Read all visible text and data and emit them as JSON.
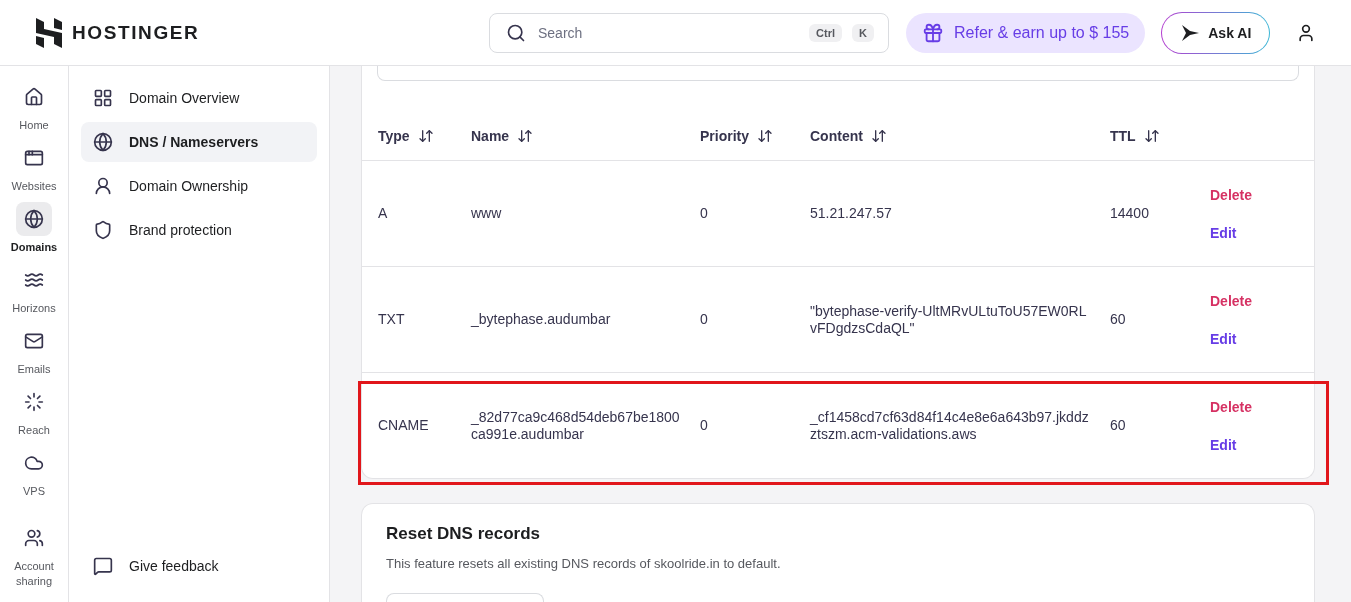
{
  "brand": {
    "name": "HOSTINGER"
  },
  "search": {
    "placeholder": "Search",
    "shortcut": [
      "Ctrl",
      "K"
    ]
  },
  "refer_button": {
    "label": "Refer & earn up to $ 155"
  },
  "ask_ai_button": {
    "label": "Ask AI"
  },
  "rail": [
    {
      "label": "Home",
      "selected": false
    },
    {
      "label": "Websites",
      "selected": false
    },
    {
      "label": "Domains",
      "selected": true
    },
    {
      "label": "Horizons",
      "selected": false
    },
    {
      "label": "Emails",
      "selected": false
    },
    {
      "label": "Reach",
      "selected": false
    },
    {
      "label": "VPS",
      "selected": false
    },
    {
      "label": "Account sharing",
      "selected": false
    }
  ],
  "subnav": {
    "items": [
      {
        "label": "Domain Overview",
        "selected": false
      },
      {
        "label": "DNS / Nameservers",
        "selected": true
      },
      {
        "label": "Domain Ownership",
        "selected": false
      },
      {
        "label": "Brand protection",
        "selected": false
      }
    ],
    "feedback": {
      "label": "Give feedback"
    }
  },
  "table": {
    "columns": [
      "Type",
      "Name",
      "Priority",
      "Content",
      "TTL"
    ],
    "rows": [
      {
        "type": "A",
        "name": "www",
        "priority": "0",
        "content": "51.21.247.57",
        "ttl": "14400",
        "delete": "Delete",
        "edit": "Edit",
        "highlighted": false
      },
      {
        "type": "TXT",
        "name": "_bytephase.audumbar",
        "priority": "0",
        "content": "\"bytephase-verify-UltMRvULtuToU57EW0RLvFDgdzsCdaQL\"",
        "ttl": "60",
        "delete": "Delete",
        "edit": "Edit",
        "highlighted": false
      },
      {
        "type": "CNAME",
        "name": "_82d77ca9c468d54deb67be1800ca991e.audumbar",
        "priority": "0",
        "content": "_cf1458cd7cf63d84f14c4e8e6a643b97.jkddzztszm.acm-validations.aws",
        "ttl": "60",
        "delete": "Delete",
        "edit": "Edit",
        "highlighted": true
      }
    ]
  },
  "reset_card": {
    "title": "Reset DNS records",
    "description": "This feature resets all existing DNS records of skoolride.in to default."
  }
}
